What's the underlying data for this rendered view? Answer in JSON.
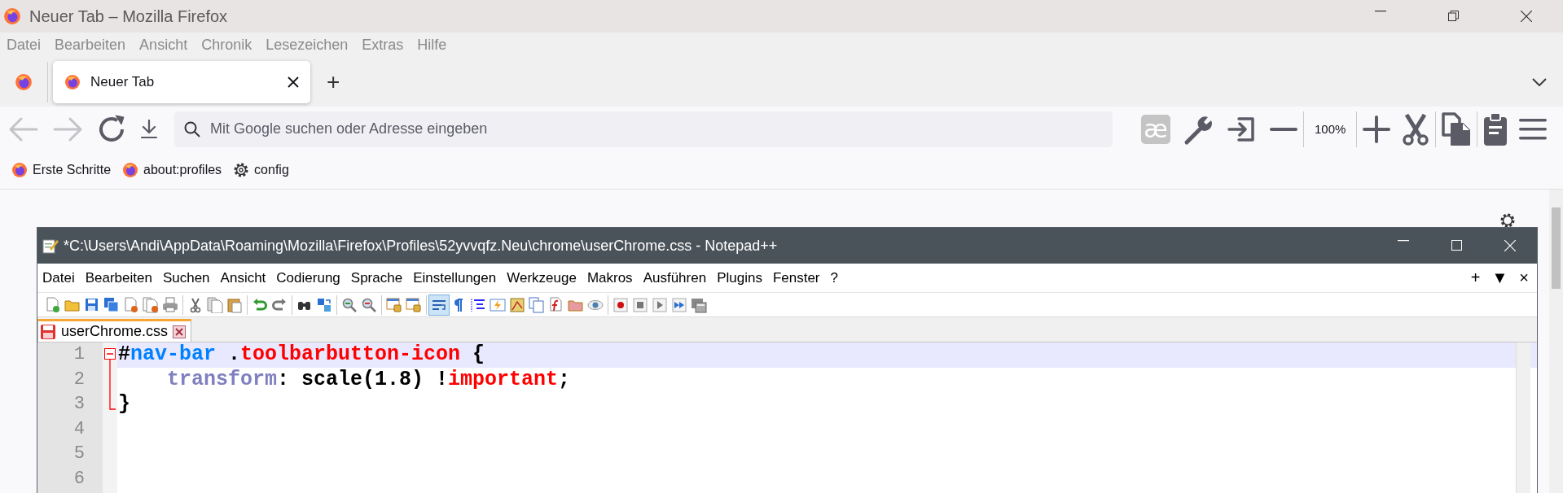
{
  "window": {
    "title": "Neuer Tab – Mozilla Firefox"
  },
  "menu": [
    "Datei",
    "Bearbeiten",
    "Ansicht",
    "Chronik",
    "Lesezeichen",
    "Extras",
    "Hilfe"
  ],
  "tabs": [
    {
      "label": "Neuer Tab",
      "selected": true
    }
  ],
  "new_tab": "+",
  "nav": {
    "back": {
      "disabled": true
    },
    "forward": {
      "disabled": true
    },
    "url_placeholder": "Mit Google suchen oder Adresse eingeben"
  },
  "toolbar": [
    {
      "kind": "extension",
      "label": "æ"
    },
    {
      "kind": "wrench"
    },
    {
      "kind": "signin"
    },
    {
      "kind": "zoom_out"
    },
    {
      "kind": "zoom_level",
      "label": "100%"
    },
    {
      "kind": "zoom_in"
    },
    {
      "kind": "cut"
    },
    {
      "kind": "copy"
    },
    {
      "kind": "paste"
    },
    {
      "kind": "menu"
    }
  ],
  "bookmarks": [
    {
      "kind": "firefox",
      "label": "Erste Schritte"
    },
    {
      "kind": "firefox",
      "label": "about:profiles"
    },
    {
      "kind": "gear",
      "label": "config"
    }
  ],
  "notepad": {
    "title": "*C:\\Users\\Andi\\AppData\\Roaming\\Mozilla\\Firefox\\Profiles\\52yvvqfz.Neu\\chrome\\userChrome.css - Notepad++",
    "menu": [
      "Datei",
      "Bearbeiten",
      "Suchen",
      "Ansicht",
      "Codierung",
      "Sprache",
      "Einstellungen",
      "Werkzeuge",
      "Makros",
      "Ausführen",
      "Plugins",
      "Fenster",
      "?"
    ],
    "menu_right": [
      "+",
      "▼",
      "×"
    ],
    "toolbar": [
      [
        {
          "kind": "new",
          "selected": false
        },
        {
          "kind": "open",
          "selected": false
        },
        {
          "kind": "save",
          "selected": false
        },
        {
          "kind": "saveall",
          "selected": false
        },
        {
          "kind": "close",
          "selected": false
        },
        {
          "kind": "closeall",
          "selected": false
        },
        {
          "kind": "print",
          "selected": false
        }
      ],
      [
        {
          "kind": "cut",
          "selected": false
        },
        {
          "kind": "copy",
          "selected": false
        },
        {
          "kind": "paste",
          "selected": false
        }
      ],
      [
        {
          "kind": "undo",
          "selected": false
        },
        {
          "kind": "redo",
          "selected": false
        }
      ],
      [
        {
          "kind": "find",
          "selected": false
        },
        {
          "kind": "replace",
          "selected": false
        }
      ],
      [
        {
          "kind": "zoomin",
          "selected": false
        },
        {
          "kind": "zoomout",
          "selected": false
        }
      ],
      [
        {
          "kind": "syncv",
          "selected": false
        },
        {
          "kind": "synch",
          "selected": false
        }
      ],
      [
        {
          "kind": "wrap",
          "selected": true
        },
        {
          "kind": "pilcrow",
          "selected": false
        },
        {
          "kind": "indent",
          "selected": false
        },
        {
          "kind": "udl",
          "selected": false
        },
        {
          "kind": "map",
          "selected": false
        },
        {
          "kind": "doclist",
          "selected": false
        },
        {
          "kind": "func",
          "selected": false
        },
        {
          "kind": "folder",
          "selected": false
        },
        {
          "kind": "eye",
          "selected": false
        }
      ],
      [
        {
          "kind": "record",
          "selected": false
        },
        {
          "kind": "stop",
          "selected": false
        },
        {
          "kind": "play",
          "selected": false
        },
        {
          "kind": "playmulti",
          "selected": false
        },
        {
          "kind": "savemacro",
          "selected": false
        }
      ]
    ],
    "tabs": [
      {
        "label": "userChrome.css",
        "selected": true,
        "modified": true
      }
    ],
    "lines": [
      {
        "number": "1",
        "current": true,
        "indented": false,
        "tokens": [
          {
            "kind": "op",
            "text": "#"
          },
          {
            "kind": "id",
            "text": "nav-bar"
          },
          {
            "kind": "op",
            "text": " ."
          },
          {
            "kind": "class",
            "text": "toolbarbutton-icon"
          },
          {
            "kind": "op",
            "text": " {"
          }
        ]
      },
      {
        "number": "2",
        "current": false,
        "indented": true,
        "tokens": [
          {
            "kind": "prop",
            "text": "transform"
          },
          {
            "kind": "op",
            "text": ": scale(1.8) !"
          },
          {
            "kind": "important",
            "text": "important"
          },
          {
            "kind": "op",
            "text": ";"
          }
        ]
      },
      {
        "number": "3",
        "current": false,
        "indented": false,
        "tokens": [
          {
            "kind": "op",
            "text": "}"
          }
        ]
      },
      {
        "number": "4",
        "current": false
      },
      {
        "number": "5",
        "current": false
      },
      {
        "number": "6",
        "current": false
      }
    ]
  }
}
